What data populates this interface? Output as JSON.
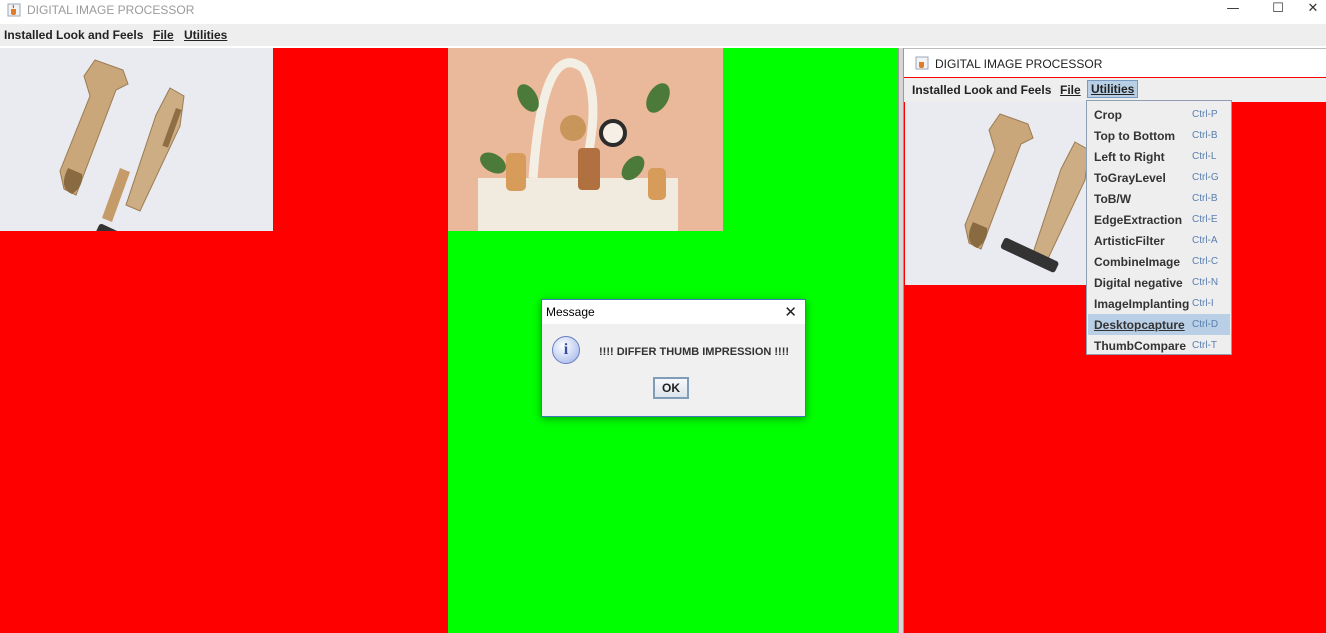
{
  "main_window": {
    "title": "DIGITAL IMAGE PROCESSOR",
    "controls": [
      "—",
      "☐",
      "✕"
    ],
    "menu": [
      "Installed Look and Feels",
      "File",
      "Utilities"
    ]
  },
  "dialog": {
    "title": "Message",
    "close": "✕",
    "message": "!!!! DIFFER THUMB IMPRESSION !!!!",
    "ok_label": "OK",
    "info_glyph": "i"
  },
  "second_window": {
    "title": "DIGITAL IMAGE PROCESSOR",
    "menu": [
      "Installed Look and Feels",
      "File",
      "Utilities"
    ]
  },
  "utilities_menu": {
    "highlighted": "Desktopcapture",
    "items": [
      {
        "label": "Crop",
        "accel": "Ctrl-P"
      },
      {
        "label": "Top to Bottom",
        "accel": "Ctrl-B"
      },
      {
        "label": "Left to Right",
        "accel": "Ctrl-L"
      },
      {
        "label": "ToGrayLevel",
        "accel": "Ctrl-G"
      },
      {
        "label": "ToB/W",
        "accel": "Ctrl-B"
      },
      {
        "label": "EdgeExtraction",
        "accel": "Ctrl-E"
      },
      {
        "label": "ArtisticFilter",
        "accel": "Ctrl-A"
      },
      {
        "label": "CombineImage",
        "accel": "Ctrl-C"
      },
      {
        "label": "Digital negative",
        "accel": "Ctrl-N"
      },
      {
        "label": "ImageImplanting",
        "accel": "Ctrl-I"
      },
      {
        "label": "Desktopcapture",
        "accel": "Ctrl-D"
      },
      {
        "label": "ThumbCompare",
        "accel": "Ctrl-T"
      }
    ]
  },
  "colors": {
    "left_panel": "#ff0000",
    "middle_panel": "#00ff00",
    "right_panel": "#ff0000",
    "menu_highlight": "#b8cfe5"
  },
  "icons": [
    "java-cup-icon",
    "minimize-icon",
    "maximize-icon",
    "close-icon",
    "info-icon"
  ]
}
